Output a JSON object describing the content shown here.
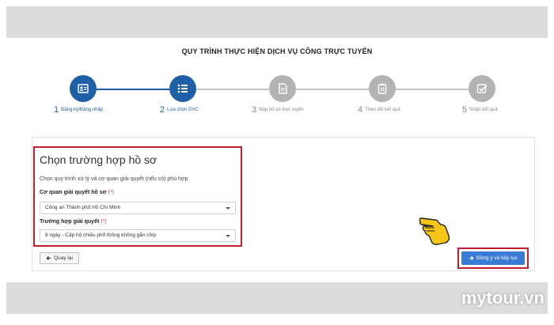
{
  "page": {
    "title": "QUY TRÌNH THỰC HIỆN DỊCH VỤ CÔNG TRỰC TUYẾN"
  },
  "steps": [
    {
      "num": "1",
      "label": "Đăng ký/Đăng nhập",
      "icon": "id-card-icon",
      "active": true
    },
    {
      "num": "2",
      "label": "Lựa chọn DVC",
      "icon": "list-icon",
      "active": true
    },
    {
      "num": "3",
      "label": "Nộp hồ sơ trực tuyến",
      "icon": "document-icon",
      "active": false
    },
    {
      "num": "4",
      "label": "Theo dõi kết quả",
      "icon": "clipboard-icon",
      "active": false
    },
    {
      "num": "5",
      "label": "Nhận kết quả",
      "icon": "check-icon",
      "active": false
    }
  ],
  "form": {
    "title": "Chọn trường hợp hồ sơ",
    "description": "Chọn quy trình xử lý và cơ quan giải quyết (nếu có) phù hợp",
    "agency_label": "Cơ quan giải quyết hồ sơ",
    "agency_required": "(*)",
    "agency_value": "Công an Thành phố Hồ Chí Minh",
    "case_label": "Trường hợp giải quyết",
    "case_required": "(*)",
    "case_value": "8 ngày - Cấp hộ chiếu phổ thông không gắn chip"
  },
  "actions": {
    "back_label": "Quay lại",
    "agree_label": "Đồng ý và tiếp tục"
  },
  "watermark": "mytour.vn",
  "colors": {
    "primary": "#1f5fa5",
    "button": "#3a7bd5",
    "highlight": "#c0202f",
    "inactive": "#b3b3b3"
  }
}
